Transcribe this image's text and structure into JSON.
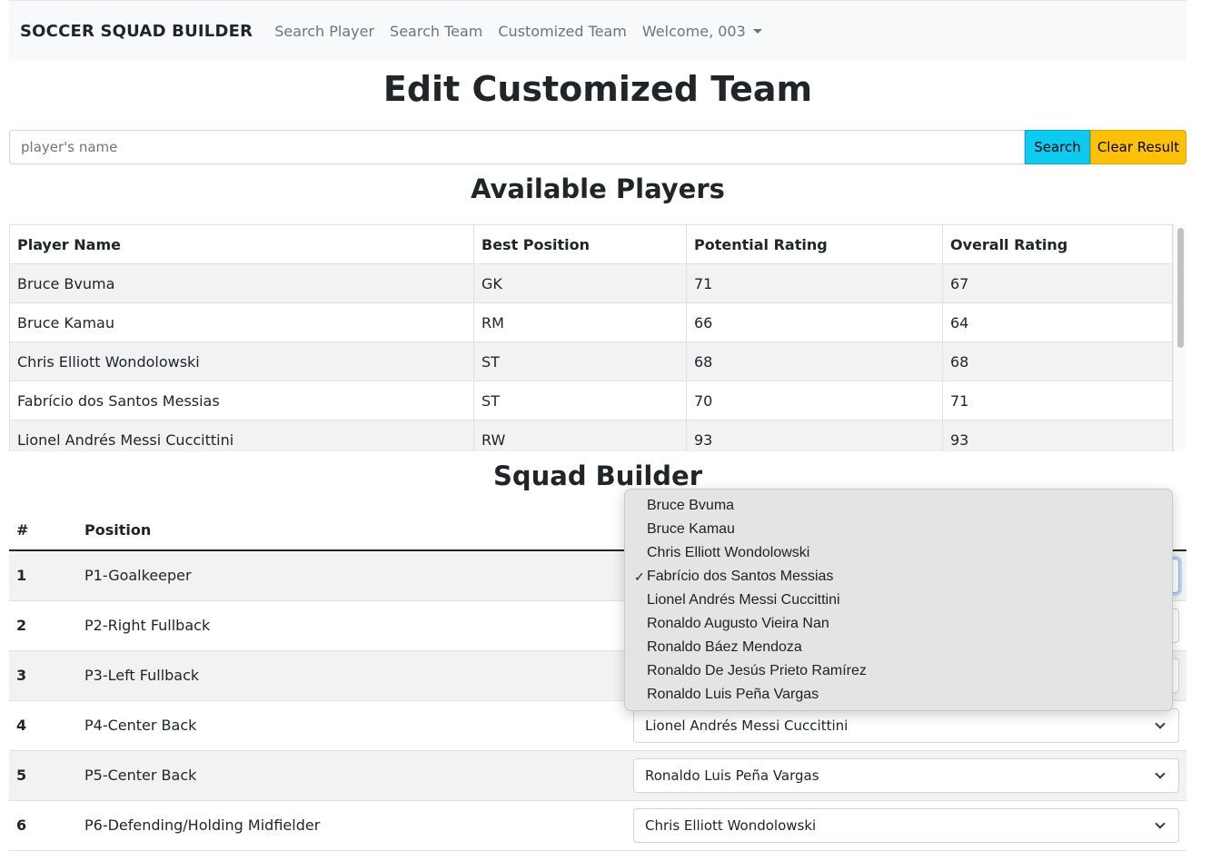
{
  "navbar": {
    "brand": "SOCCER SQUAD BUILDER",
    "links": [
      "Search Player",
      "Search Team",
      "Customized Team"
    ],
    "user_menu": "Welcome, 003"
  },
  "page_title": "Edit Customized Team",
  "search": {
    "placeholder": "player's name",
    "value": "",
    "search_label": "Search",
    "clear_label": "Clear Result"
  },
  "available_players": {
    "title": "Available Players",
    "columns": [
      "Player Name",
      "Best Position",
      "Potential Rating",
      "Overall Rating"
    ],
    "rows": [
      [
        "Bruce Bvuma",
        "GK",
        "71",
        "67"
      ],
      [
        "Bruce Kamau",
        "RM",
        "66",
        "64"
      ],
      [
        "Chris Elliott Wondolowski",
        "ST",
        "68",
        "68"
      ],
      [
        "Fabrício dos Santos Messias",
        "ST",
        "70",
        "71"
      ],
      [
        "Lionel Andrés Messi Cuccittini",
        "RW",
        "93",
        "93"
      ]
    ]
  },
  "squad_builder": {
    "title": "Squad Builder",
    "columns": [
      "#",
      "Position"
    ],
    "rows": [
      {
        "num": "1",
        "position": "P1-Goalkeeper",
        "selected": ""
      },
      {
        "num": "2",
        "position": "P2-Right Fullback",
        "selected": ""
      },
      {
        "num": "3",
        "position": "P3-Left Fullback",
        "selected": ""
      },
      {
        "num": "4",
        "position": "P4-Center Back",
        "selected": "Lionel Andrés Messi Cuccittini"
      },
      {
        "num": "5",
        "position": "P5-Center Back",
        "selected": "Ronaldo Luis Peña Vargas"
      },
      {
        "num": "6",
        "position": "P6-Defending/Holding Midfielder",
        "selected": "Chris Elliott Wondolowski"
      }
    ]
  },
  "dropdown": {
    "check_mark": "✓",
    "options": [
      "Bruce Bvuma",
      "Bruce Kamau",
      "Chris Elliott Wondolowski",
      "Fabrício dos Santos Messias",
      "Lionel Andrés Messi Cuccittini",
      "Ronaldo Augusto Vieira Nan",
      "Ronaldo Báez Mendoza",
      "Ronaldo De Jesús Prieto Ramírez",
      "Ronaldo Luis Peña Vargas"
    ]
  },
  "colors": {
    "search_button": "#0dcaf0",
    "clear_button": "#ffc107",
    "navbar_bg": "#f8f9fa"
  }
}
